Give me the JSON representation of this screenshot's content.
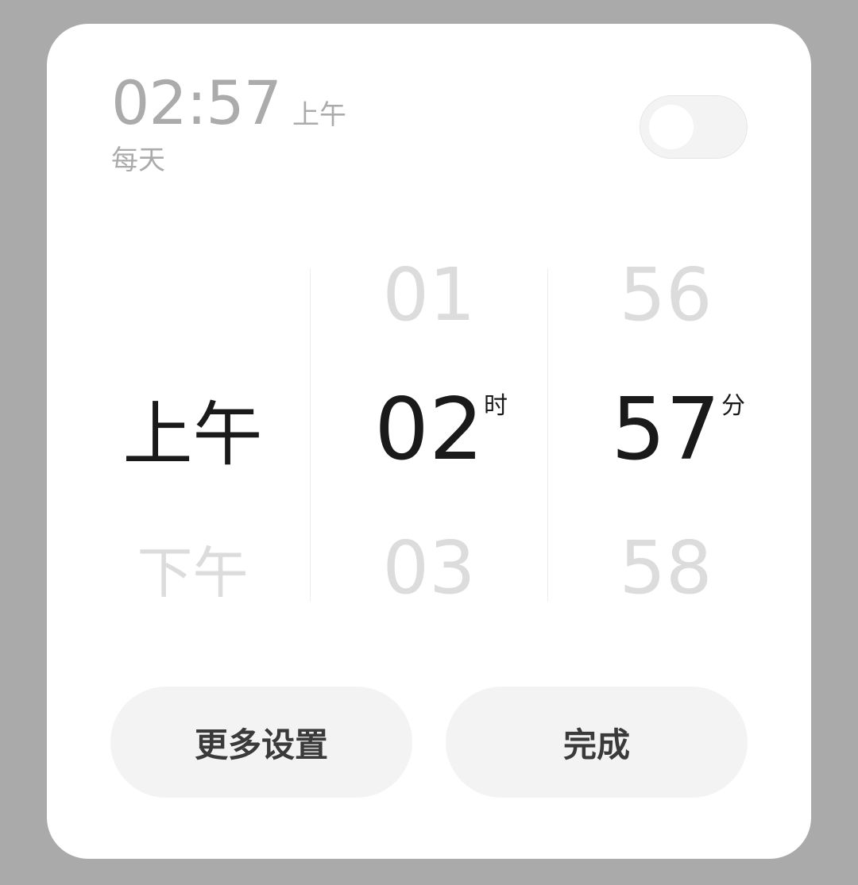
{
  "summary": {
    "time": "02:57",
    "ampm": "上午",
    "repeat": "每天"
  },
  "toggle": {
    "enabled": false
  },
  "picker": {
    "period": {
      "selected": "上午",
      "next": "下午"
    },
    "hour": {
      "prev": "01",
      "selected": "02",
      "next": "03",
      "unit": "时"
    },
    "minute": {
      "prev": "56",
      "selected": "57",
      "next": "58",
      "unit": "分"
    }
  },
  "buttons": {
    "more_settings": "更多设置",
    "done": "完成"
  },
  "colors": {
    "backdrop": "#aaaaaa",
    "card": "#ffffff",
    "selected_text": "#1a1a1a",
    "faded_text": "#dcdcdc",
    "summary_text": "#ababab",
    "button_bg": "#f3f3f3"
  }
}
